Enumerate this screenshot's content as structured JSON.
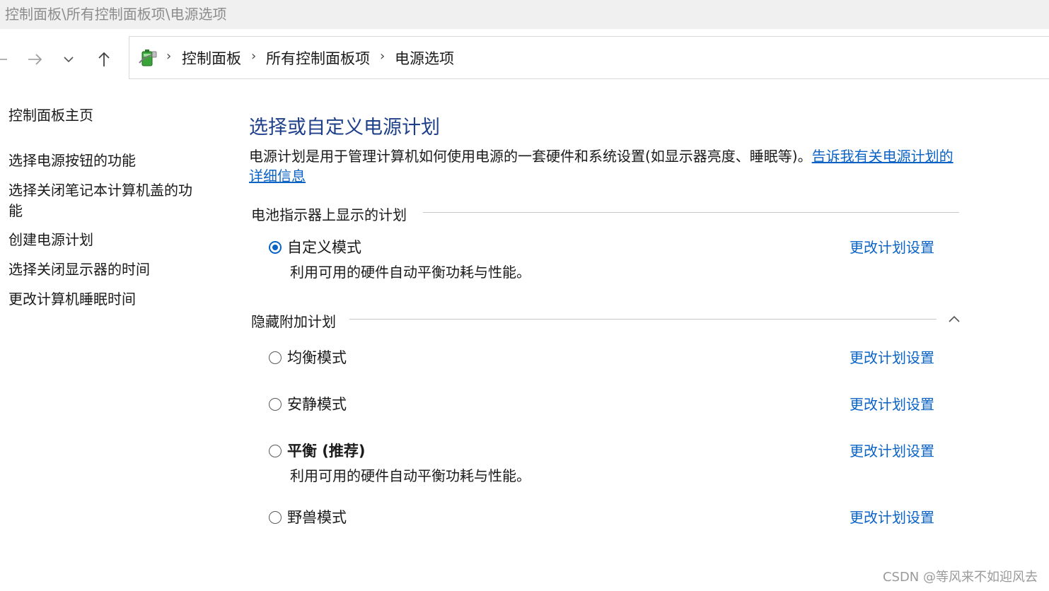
{
  "window": {
    "title": "控制面板\\所有控制面板项\\电源选项"
  },
  "nav": {
    "back_icon": "arrow-left-icon",
    "forward_icon": "arrow-right-icon",
    "recent_icon": "chevron-down-icon",
    "up_icon": "arrow-up-icon",
    "breadcrumb": [
      "控制面板",
      "所有控制面板项",
      "电源选项"
    ],
    "separator": "›",
    "location_icon": "power-options-icon"
  },
  "sidebar": {
    "home": "控制面板主页",
    "links": [
      "选择电源按钮的功能",
      "选择关闭笔记本计算机盖的功",
      "能",
      "创建电源计划",
      "选择关闭显示器的时间",
      "更改计算机睡眠时间"
    ]
  },
  "main": {
    "title": "选择或自定义电源计划",
    "description": "电源计划是用于管理计算机如何使用电源的一套硬件和系统设置(如显示器亮度、睡眠等)。",
    "description_link": "告诉我有关电源计划的详细信息",
    "battery_group": {
      "header": "电池指示器上显示的计划",
      "plans": [
        {
          "name": "自定义模式",
          "selected": true,
          "desc": "利用可用的硬件自动平衡功耗与性能。",
          "action": "更改计划设置"
        }
      ]
    },
    "hidden_group": {
      "header": "隐藏附加计划",
      "collapse_icon": "chevron-up-icon",
      "plans": [
        {
          "name": "均衡模式",
          "selected": false,
          "desc": "",
          "action": "更改计划设置"
        },
        {
          "name": "安静模式",
          "selected": false,
          "desc": "",
          "action": "更改计划设置"
        },
        {
          "name": "平衡 (推荐)",
          "selected": false,
          "desc": "利用可用的硬件自动平衡功耗与性能。",
          "action": "更改计划设置"
        },
        {
          "name": "野兽模式",
          "selected": false,
          "desc": "",
          "action": "更改计划设置"
        }
      ]
    }
  },
  "watermark": "CSDN @等风来不如迎风去",
  "colors": {
    "accent": "#0b63c5",
    "title": "#1e3f8a",
    "titlebar": "#f0f0f0"
  }
}
